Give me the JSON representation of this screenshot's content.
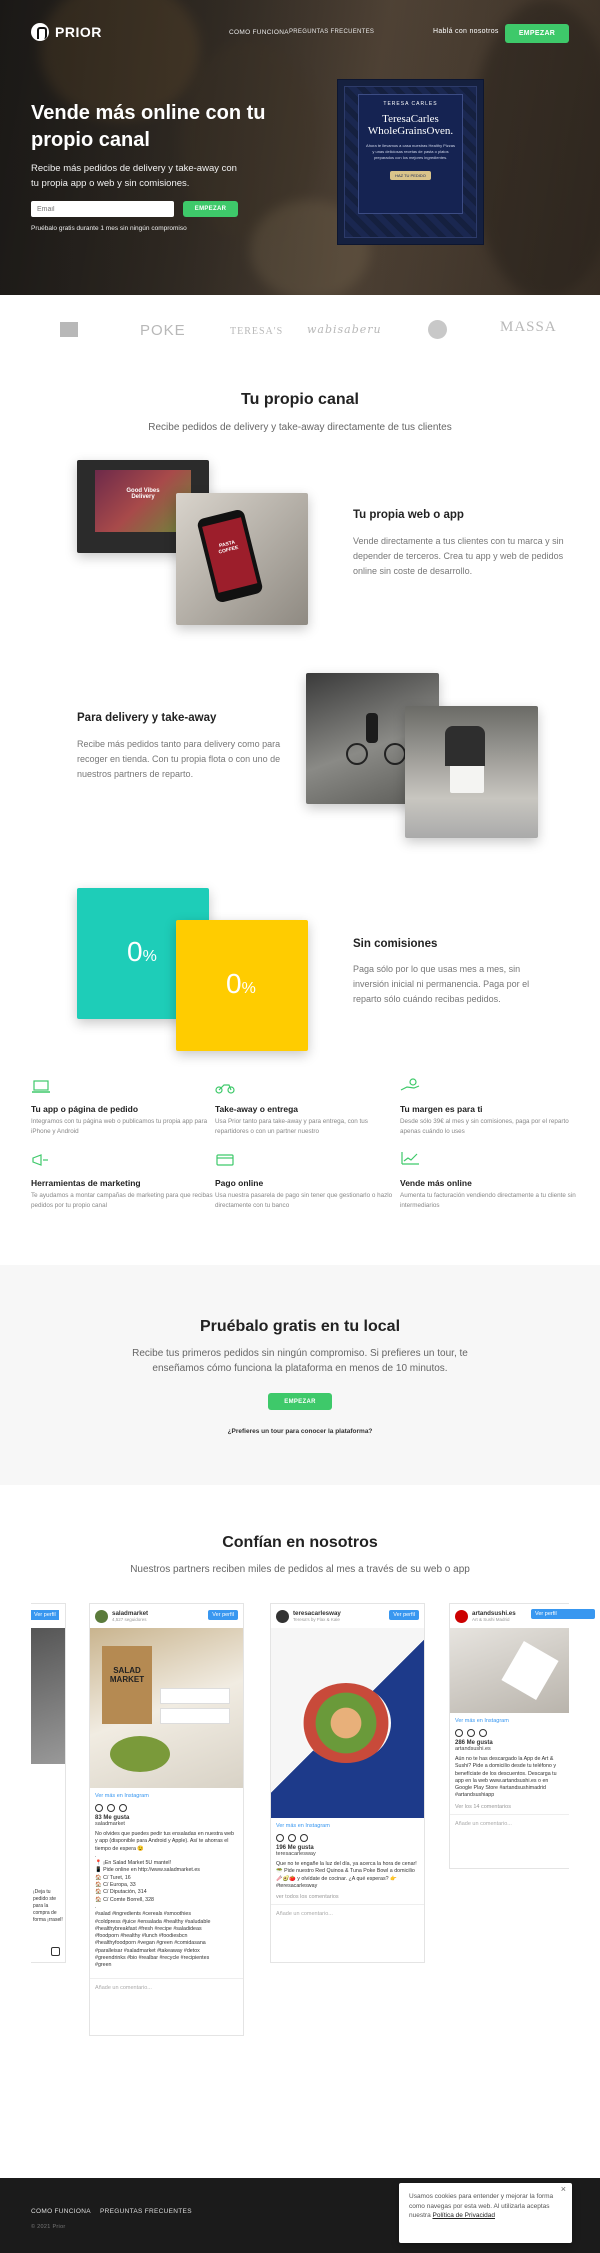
{
  "brand": "PRIOR",
  "nav": {
    "item1": "COMO FUNCIONA",
    "item2": "PREGUNTAS FRECUENTES",
    "talk": "Hablá con nosotros",
    "cta": "EMPEZAR"
  },
  "hero": {
    "title": "Vende más online con tu propio canal",
    "subtitle": "Recibe más pedidos de delivery y take-away con tu propia app o web y sin comisiones.",
    "email_placeholder": "Email",
    "button": "EMPEZAR",
    "trial": "Pruébalo gratis durante 1 mes sin ningún compromiso",
    "card": {
      "brand": "TERESA CARLES",
      "title": "TeresaCarles WholeGrainsOven.",
      "text": "Ahora te llevamos a casa nuestras Healthy Pizzas y unas deliciosas recetas de pasta o platos preparados con los mejores ingredientes.",
      "cta": "HAZ TU PEDIDO"
    }
  },
  "logos": [
    "",
    "POKE",
    "TERESA'S",
    "wabisaberu",
    "",
    "MASSA"
  ],
  "canal": {
    "title": "Tu propio canal",
    "lead": "Recibe pedidos de delivery y take-away directamente de tus clientes"
  },
  "features": [
    {
      "title": "Tu propia web o app",
      "text": "Vende directamente a tus clientes con tu marca y sin depender de terceros. Crea tu app y web de pedidos online sin coste de desarrollo."
    },
    {
      "title": "Para delivery y take-away",
      "text": "Recibe más pedidos tanto para delivery como para recoger en tienda. Con tu propia flota o con uno de nuestros partners de reparto."
    },
    {
      "title": "Sin comisiones",
      "text": "Paga sólo por lo que usas mes a mes, sin inversión inicial ni permanencia. Paga por el reparto sólo cuándo recibas pedidos."
    }
  ],
  "zero": {
    "a": "0",
    "b": "0",
    "pct": "%"
  },
  "mini": [
    {
      "title": "Tu app o página de pedido",
      "text": "Integramos con tu página web o publicamos tu propia app para iPhone y Android",
      "icon": "laptop-icon"
    },
    {
      "title": "Take-away o entrega",
      "text": "Usa Prior tanto para take-away y para entrega, con tus repartidores o con un partner nuestro",
      "icon": "scooter-icon"
    },
    {
      "title": "Tu margen es para ti",
      "text": "Desde sólo 39€ al mes y sin comisiones, paga por el reparto apenas cuándo lo uses",
      "icon": "hand-coin-icon"
    },
    {
      "title": "Herramientas de marketing",
      "text": "Te ayudamos a montar campañas de marketing para que recibas pedidos por tu propio canal",
      "icon": "megaphone-icon"
    },
    {
      "title": "Pago online",
      "text": "Usa nuestra pasarela de pago sin tener que gestionarlo o hazlo directamente con tu banco",
      "icon": "card-icon"
    },
    {
      "title": "Vende más online",
      "text": "Aumenta tu facturación vendiendo directamente a tu cliente sin intermediarios",
      "icon": "chart-icon"
    }
  ],
  "trial_section": {
    "title": "Pruébalo gratis en tu local",
    "lead": "Recibe tus primeros pedidos sin ningún compromiso. Si prefieres un tour, te enseñamos cómo funciona la plataforma en menos de 10 minutos.",
    "button": "EMPEZAR",
    "link": "¿Prefieres un tour para conocer la plataforma?"
  },
  "partners": {
    "title": "Confían en nosotros",
    "lead": "Nuestros partners reciben miles de pedidos al mes a través de su web o app"
  },
  "ig": [
    {
      "name": "saladmarket",
      "sub": "4,527 seguidores",
      "follow": "Ver perfil",
      "link": "Ver más en Instagram",
      "likes": "83 Me gusta",
      "user": "saladmarket",
      "text": "No olvides que puedes pedir tus ensaladas en nuestra web y app (disponible para Android y Apple). Así te ahorras el tiempo de espera 😉\n.\n📍 ¡En Salad Market 5U mantel!\n📱 Pide online en http://www.saladmarket.es\n🏠 C/ Turet, 16\n🏠 C/ Europa, 33\n🏠 C/ Diputación, 314\n🏠 C/ Comte Borrell, 328\n.\n#salad #ingredients #cereals #smoothies\n#coldpress #juice #ensalada #healthy #saludable\n#healthybreakfast #fresh #recipe #saladideas\n#foodporn #healthy #lunch #foodiesbcn\n#healthyfoodporn #vegan #green #comidasana\n#paralleisar #saladmarket #takeaway #detox\n#greendrinks #bio #realbar #recycle #recipientes\n#green",
      "comment": "Añade un comentario..."
    },
    {
      "name": "teresacarlesway",
      "sub": "Teresa's by Flax & Kale",
      "follow": "Ver perfil",
      "link": "Ver más en Instagram",
      "likes": "196 Me gusta",
      "user": "teresacarlesway",
      "text": "Que no te engañe la luz del día, ya acerca la hora de cenar! 🥗 Pide nuestro Red Quinoa & Tuna Poke Bowl a domicilio 🥢🥑🍅 y olvídate de cocinar. ¿A qué esperas? 👉 #teresacarlesway",
      "more": "ver todos los comentarios",
      "comment": "Añade un comentario..."
    },
    {
      "name": "artandsushi.es",
      "sub": "Art & Sushi Madrid",
      "follow": "Ver perfil",
      "link": "Ver más en Instagram",
      "likes": "286 Me gusta",
      "user": "artandsushi.es",
      "text": "Aún no te has descargado la App de Art & Sushi? Pide a domicilio desde tu teléfono y benefíciate de los descuentos. Descarga tu app en la web www.artandsushi.es o en Google Play Store #artandsushimadrid #artandsushiapp",
      "more": "Ver los 14 comentarios",
      "comment": "Añade un comentario..."
    },
    {
      "name": "",
      "follow": "Ver perfil",
      "text": "¡Deja tu pedido ste para la compra de forma ¡rrasel!"
    }
  ],
  "footer": {
    "link1": "COMO FUNCIONA",
    "link2": "PREGUNTAS FRECUENTES",
    "copy": "© 2021 Prior"
  },
  "cookie": {
    "text": "Usamos cookies para entender y mejorar la forma como navegas por esta web. Al utilizarla aceptas nuestra",
    "link": "Política de Privacidad",
    "close": "×"
  },
  "colors": {
    "green": "#3ec96a",
    "teal": "#1ecdb8",
    "yellow": "#ffcc00",
    "navy": "#152352",
    "blue": "#3897f0"
  }
}
